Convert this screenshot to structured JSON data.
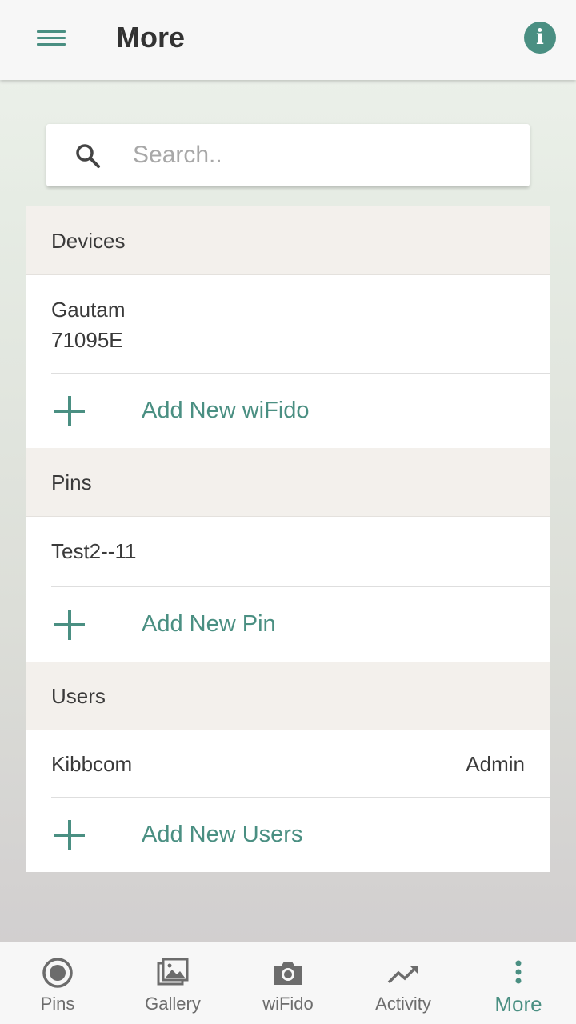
{
  "header": {
    "title": "More",
    "menu_icon": "hamburger-menu-icon",
    "info_icon": "info-icon",
    "info_glyph": "i",
    "accent_color": "#4a8f82"
  },
  "search": {
    "placeholder": "Search..",
    "value": ""
  },
  "sections": {
    "devices": {
      "header": "Devices",
      "items": [
        {
          "name": "Gautam",
          "id": "71095E"
        }
      ],
      "add_label": "Add New wiFido"
    },
    "pins": {
      "header": "Pins",
      "items": [
        {
          "name": "Test2--11"
        }
      ],
      "add_label": "Add New Pin"
    },
    "users": {
      "header": "Users",
      "items": [
        {
          "name": "Kibbcom",
          "role": "Admin"
        }
      ],
      "add_label": "Add New Users"
    }
  },
  "bottom_nav": {
    "items": [
      {
        "label": "Pins",
        "icon": "radio-target-icon",
        "active": false
      },
      {
        "label": "Gallery",
        "icon": "gallery-icon",
        "active": false
      },
      {
        "label": "wiFido",
        "icon": "camera-icon",
        "active": false
      },
      {
        "label": "Activity",
        "icon": "trending-up-icon",
        "active": false
      },
      {
        "label": "More",
        "icon": "more-vertical-icon",
        "active": true
      }
    ]
  }
}
